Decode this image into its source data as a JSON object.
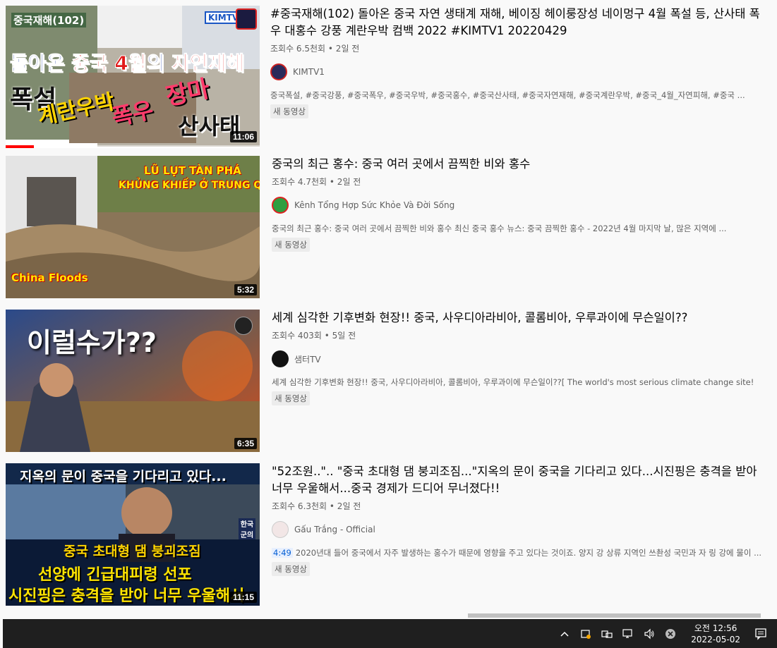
{
  "results": [
    {
      "title": "#중국재해(102) 돌아온 중국 자연 생태계 재해, 베이징 헤이룽장성 네이멍구 4월 폭설 등, 산사태 폭우 대홍수 강풍 계란우박 컴백 2022 #KIMTV1 20220429",
      "meta": "조회수 6.5천회 • 2일 전",
      "channel": "KIMTV1",
      "description": "중국폭설, #중국강풍, #중국폭우, #중국우박, #중국홍수, #중국산사태, #중국자연재해, #중국계란우박, #중국_4월_자연피해, #중국 ...",
      "badge": "새 동영상",
      "duration": "11:06",
      "progress": 0.11,
      "thumb_text": {
        "top": "중국재해(102)",
        "line1a": "돌아온 ",
        "line1b": "중국 4월",
        "line1c": "의 ",
        "line1d": "자연재해",
        "w1": "폭설",
        "w2": "계란우박",
        "w3": "폭우",
        "w4": "장마",
        "w5": "산사태",
        "logo": "KIMTV"
      }
    },
    {
      "title": "중국의 최근 홍수: 중국 여러 곳에서 끔찍한 비와 홍수",
      "meta": "조회수 4.7천회 • 2일 전",
      "channel": "Kênh Tổng Hợp Sức Khỏe Và Đời Sống",
      "description": "중국의 최근 홍수: 중국 여러 곳에서 끔찍한 비와 홍수 최신 중국 홍수 뉴스: 중국 끔찍한 홍수 - 2022년 4월 마지막 날, 많은 지역에 ...",
      "badge": "새 동영상",
      "duration": "5:32",
      "thumb_text": {
        "line1": "LŨ LỤT TÀN PHÁ",
        "line2": "KHỦNG KHIẾP Ở TRUNG QUỐC",
        "bottom": "China Floods"
      }
    },
    {
      "title": "세계 심각한 기후변화 현장!! 중국, 사우디아라비아, 콜롬비아, 우루과이에 무슨일이??",
      "meta": "조회수 403회 • 5일 전",
      "channel": "샘터TV",
      "description": "세계 심각한 기후변화 현장!! 중국, 사우디아라비아, 콜롬비아, 우루과이에 무슨일이??[ The world's most serious climate change site!",
      "badge": "새 동영상",
      "duration": "6:35",
      "thumb_text": {
        "line1": "이럴수가??"
      }
    },
    {
      "title": "\"52조원..\".. \"중국 초대형 댐 붕괴조짐...\"지옥의 문이 중국을 기다리고 있다...시진핑은 충격을 받아 너무 우울해서...중국 경제가 드디어 무너졌다!!",
      "meta": "조회수 6.3천회 • 2일 전",
      "channel": "Gấu Trắng - Official",
      "chapter": "4:49",
      "description": "2020년대 들어 중국에서 자주 발생하는 홍수가 때문에 영향을 주고 있다는 것이죠. 양지 강 상류 지역인 쓰촨성 국민과 자 링 강에 물이 ...",
      "badge": "새 동영상",
      "duration": "11:15",
      "thumb_text": {
        "line1": "지옥의 문이 중국을 기다리고 있다...",
        "line2": "중국 초대형 댐 붕괴조짐",
        "line3": "선양에 긴급대피령 선포",
        "line4": "시진핑은 충격을 받아 너무 우울해서",
        "tag": "한국 군의"
      }
    }
  ],
  "taskbar": {
    "time": "오전 12:56",
    "date": "2022-05-02",
    "icons": [
      "chevron-up-icon",
      "security-icon",
      "input-icon",
      "network-icon",
      "volume-icon",
      "close-circle-icon",
      "notification-icon"
    ]
  }
}
